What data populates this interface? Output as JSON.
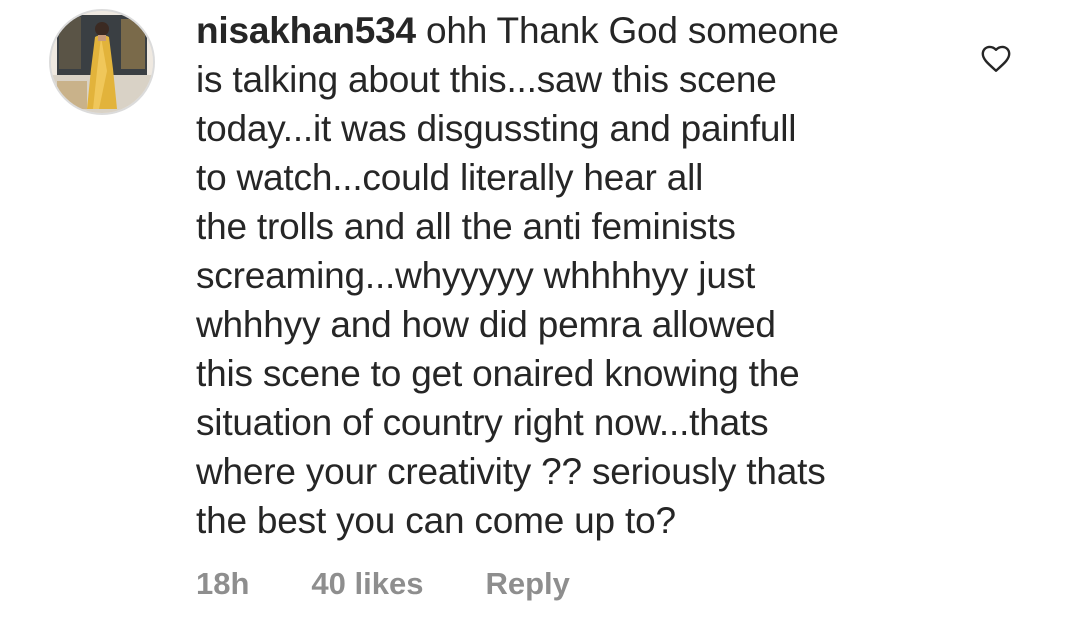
{
  "comment": {
    "username": "nisakhan534",
    "text": " ohh Thank God someone\nis talking about this...saw this scene\ntoday...it was disgussting and painfull\nto watch...could literally hear all\nthe trolls and all the anti feminists\nscreaming...whyyyyy whhhhyy just\nwhhhyy and how did pemra allowed\nthis scene to get onaired knowing the\nsituation of country right now...thats\nwhere your creativity ?? seriously thats\nthe best you can come up to?",
    "time": "18h",
    "likes": "40 likes",
    "reply_label": "Reply",
    "avatar_icon": "avatar-photo",
    "like_icon": "heart-outline-icon"
  },
  "colors": {
    "text": "#262626",
    "meta": "#8e8e8e",
    "icon": "#262626"
  }
}
